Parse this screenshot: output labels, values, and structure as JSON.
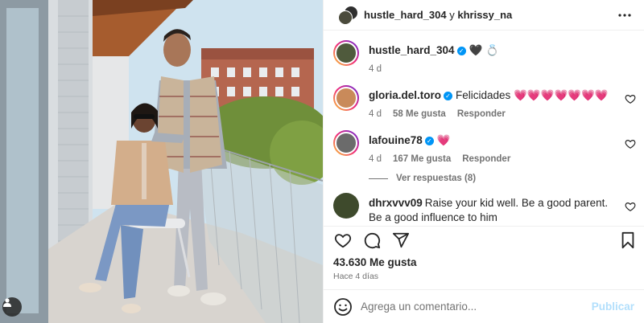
{
  "header": {
    "user_a": "hustle_hard_304",
    "joiner": "y",
    "user_b": "khrissy_na"
  },
  "caption": {
    "username": "hustle_hard_304",
    "text": "🖤 💍",
    "time": "4 d"
  },
  "comments": [
    {
      "username": "gloria.del.toro",
      "verified": true,
      "text": "Felicidades 💗💗💗💗💗💗💗",
      "time": "4 d",
      "likes": "58 Me gusta",
      "reply": "Responder",
      "avatar_color": "#c98a5a"
    },
    {
      "username": "lafouine78",
      "verified": true,
      "text": "💗",
      "time": "4 d",
      "likes": "167 Me gusta",
      "reply": "Responder",
      "avatar_color": "#6b6b6b"
    },
    {
      "username": "dhrxvvv09",
      "verified": false,
      "text": "Raise your kid well. Be a good parent. Be a good influence to him",
      "avatar_color": "#3e4a2c"
    }
  ],
  "view_replies": "Ver respuestas (8)",
  "likes_count": "43.630 Me gusta",
  "posted_ago": "Hace 4 días",
  "composer": {
    "placeholder": "Agrega un comentario...",
    "post_label": "Publicar"
  },
  "colors": {
    "accent": "#0095f6",
    "post_disabled": "#b2dffc",
    "heart": "#e0245e"
  }
}
